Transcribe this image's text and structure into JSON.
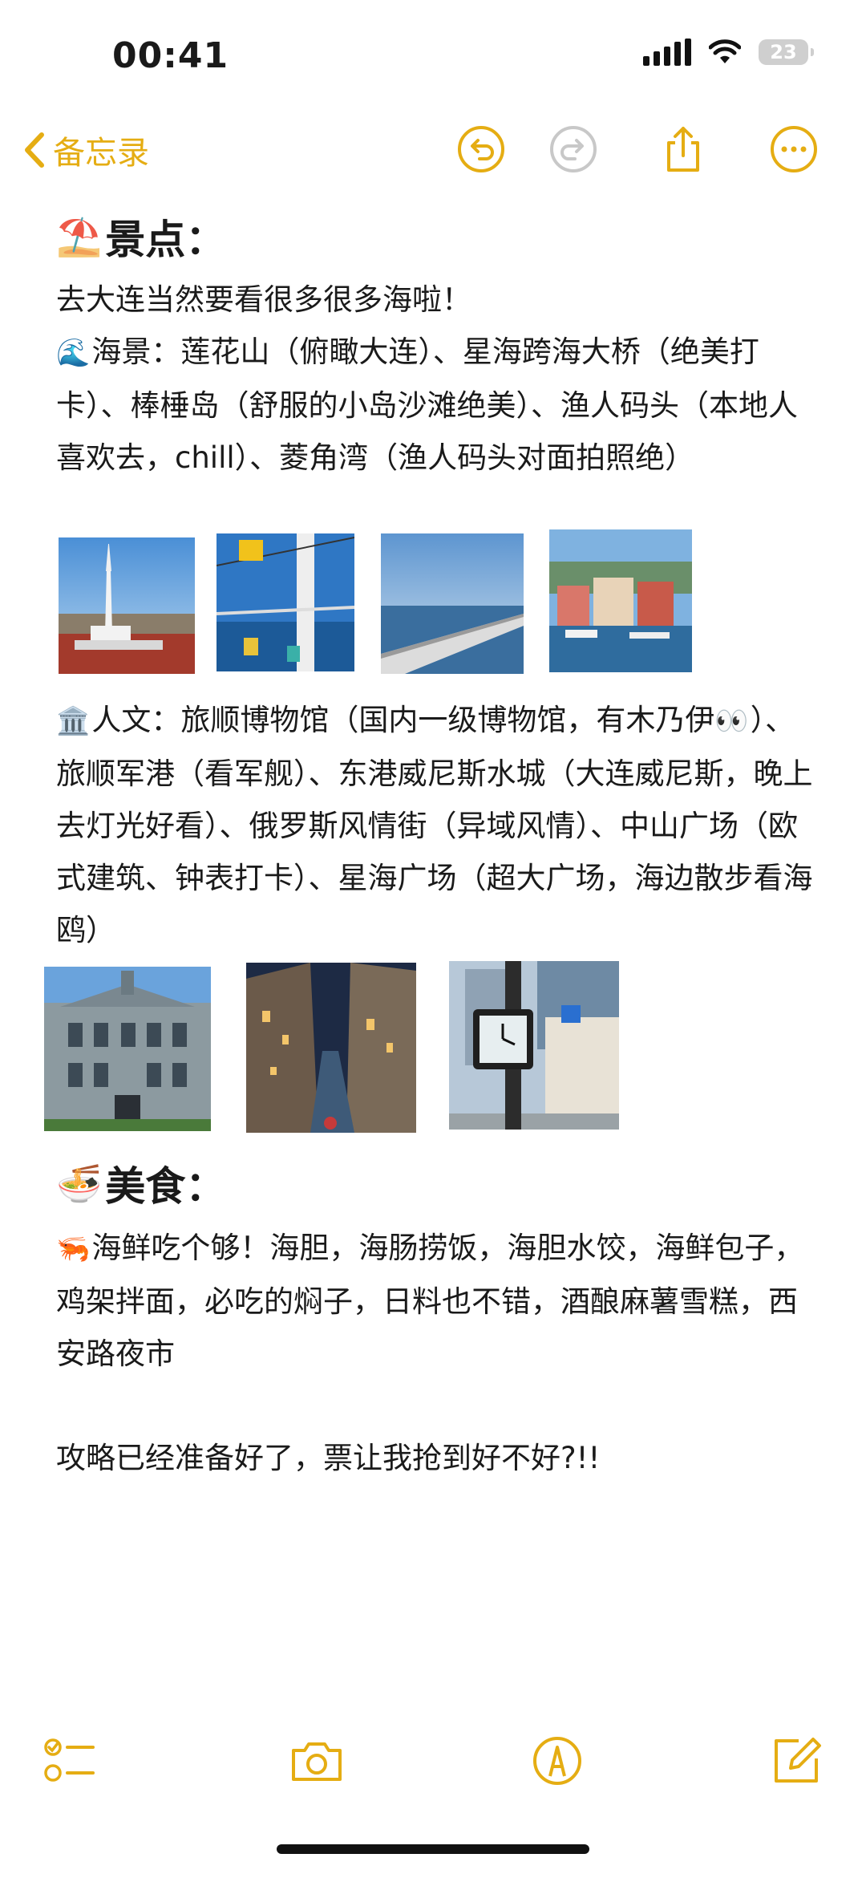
{
  "status_bar": {
    "time": "00:41",
    "battery": "23"
  },
  "nav": {
    "back_label": "备忘录"
  },
  "note": {
    "section_attractions": {
      "emoji": "⛱️",
      "title": "景点："
    },
    "intro": "去大连当然要看很多很多海啦！",
    "seaview": {
      "emoji": "🌊",
      "text": "海景：莲花山（俯瞰大连）、星海跨海大桥（绝美打卡）、棒棰岛（舒服的小岛沙滩绝美）、渔人码头（本地人喜欢去，chill）、菱角湾（渔人码头对面拍照绝）"
    },
    "culture": {
      "emoji": "🏛️",
      "text_before": "人文：旅顺博物馆（国内一级博物馆，有木乃伊",
      "eyes": "👀",
      "text_after": "）、旅顺军港（看军舰）、东港威尼斯水城（大连威尼斯，晚上去灯光好看）、俄罗斯风情街（异域风情）、中山广场（欧式建筑、钟表打卡）、星海广场（超大广场，海边散步看海鸥）"
    },
    "section_food": {
      "emoji": "🍜",
      "title": "美食："
    },
    "food": {
      "emoji": "🦐",
      "text": "海鲜吃个够！海胆，海肠捞饭，海胆水饺，海鲜包子，鸡架拌面，必吃的焖子，日料也不错，酒酿麻薯雪糕，西安路夜市"
    },
    "closing": "攻略已经准备好了，票让我抢到好不好?!!"
  },
  "icons": {
    "back": "chevron-left-icon",
    "undo": "undo-icon",
    "redo": "redo-icon",
    "share": "share-icon",
    "more": "more-icon",
    "checklist": "checklist-icon",
    "camera": "camera-icon",
    "markup": "markup-pen-icon",
    "compose": "compose-icon"
  },
  "colors": {
    "accent": "#e5ad13",
    "redo_disabled": "#c8c8c8",
    "text": "#1a1a1a"
  }
}
